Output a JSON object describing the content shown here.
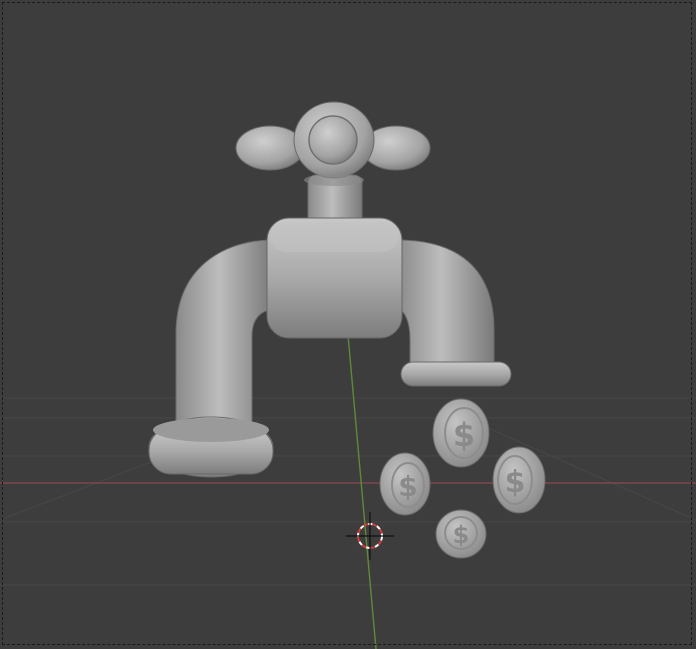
{
  "viewport": {
    "background": "#3d3d3d",
    "grid_color": "#474747",
    "x_axis_color": "#8a4a52",
    "y_axis_color": "#5e8a3a",
    "clay_color": "#b0b0b0"
  },
  "scene": {
    "objects": [
      {
        "name": "faucet-handle",
        "icon": "cross-handle"
      },
      {
        "name": "faucet-stem",
        "icon": "stem"
      },
      {
        "name": "faucet-body",
        "icon": "body"
      },
      {
        "name": "faucet-pipe-left",
        "icon": "pipe"
      },
      {
        "name": "faucet-spout-right",
        "icon": "spout"
      },
      {
        "name": "coin",
        "symbol": "$"
      },
      {
        "name": "coin",
        "symbol": "$"
      },
      {
        "name": "coin",
        "symbol": "$"
      },
      {
        "name": "coin",
        "symbol": "$"
      }
    ],
    "cursor": {
      "icon": "3d-cursor-icon"
    }
  }
}
